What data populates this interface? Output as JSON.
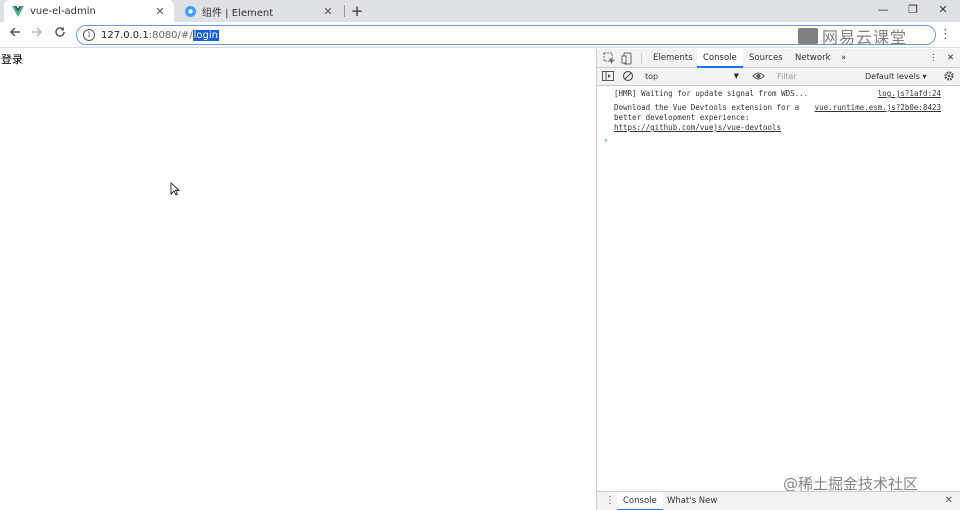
{
  "browser": {
    "tabs": [
      {
        "title": "vue-el-admin",
        "favicon": "vue-logo-icon",
        "active": true
      },
      {
        "title": "组件 | Element",
        "favicon": "element-logo-icon",
        "active": false
      }
    ],
    "close_glyph": "✕",
    "new_tab_glyph": "+",
    "window": {
      "minimize": "—",
      "maximize": "❐",
      "close": "✕"
    },
    "address": {
      "host": "127.0.0.1",
      "path": ":8080/#/",
      "selected": "login"
    },
    "menu_glyph": "⋮"
  },
  "watermarks": {
    "top": "网易云课堂",
    "bottom": "@稀土掘金技术社区"
  },
  "page": {
    "text": "登录"
  },
  "devtools": {
    "tabs": [
      "Elements",
      "Console",
      "Sources",
      "Network"
    ],
    "active_tab": "Console",
    "more_glyph": "»",
    "context": "top",
    "filter_placeholder": "Filter",
    "levels": "Default levels ▾",
    "messages": [
      {
        "text": "[HMR] Waiting for update signal from WDS...",
        "source": "log.js?1afd:24"
      },
      {
        "text": "Download the Vue Devtools extension for a better development experience:",
        "source": "vue.runtime.esm.js?2b0e:8423",
        "link": "https://github.com/vuejs/vue-devtools"
      }
    ],
    "prompt_glyph": "›",
    "drawer": {
      "tabs": [
        "Console",
        "What's New"
      ],
      "active": "Console"
    }
  },
  "colors": {
    "accent": "#1a73e8",
    "selection": "#1b5fd1",
    "tabstrip": "#dee1e6"
  }
}
